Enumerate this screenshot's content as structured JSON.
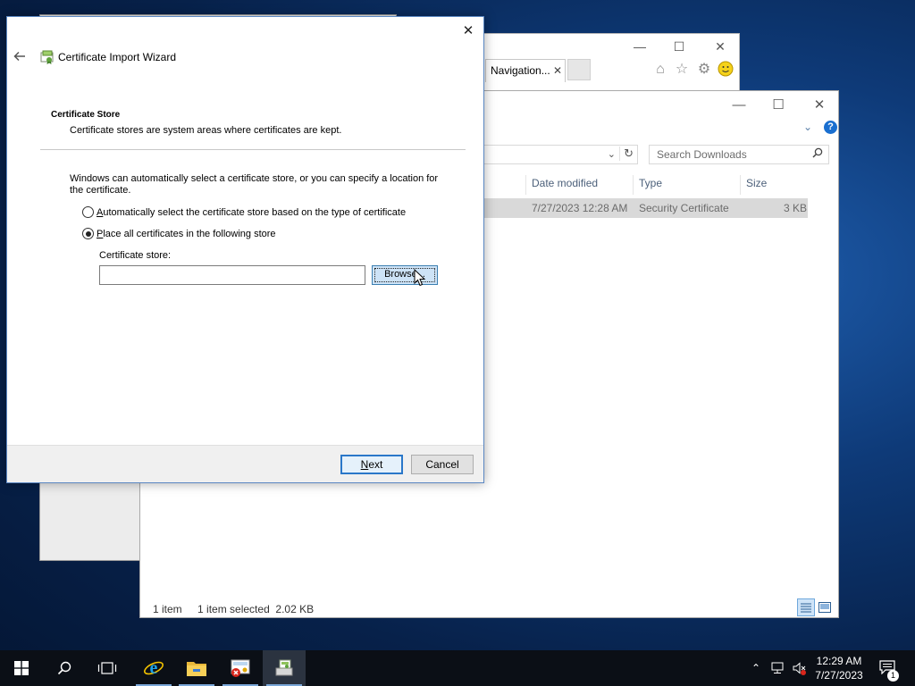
{
  "ie": {
    "tab_label": "Navigation...",
    "tab_close": "✕",
    "minimize": "—",
    "maximize": "☐",
    "close": "✕"
  },
  "explorer": {
    "minimize": "—",
    "maximize": "☐",
    "close": "✕",
    "search_placeholder": "Search Downloads",
    "columns": [
      "Date modified",
      "Type",
      "Size"
    ],
    "file": {
      "date_modified": "7/27/2023 12:28 AM",
      "type": "Security Certificate",
      "size": "3 KB"
    },
    "status_count": "1 item",
    "status_selection": "1 item selected  2.02 KB",
    "help_glyph": "?"
  },
  "wizard": {
    "title": "Certificate Import Wizard",
    "close": "✕",
    "section_title": "Certificate Store",
    "section_desc": "Certificate stores are system areas where certificates are kept.",
    "intro": "Windows can automatically select a certificate store, or you can specify a location for the certificate.",
    "option_auto": {
      "accel": "A",
      "rest": "utomatically select the certificate store based on the type of certificate",
      "checked": false
    },
    "option_place": {
      "accel": "P",
      "rest": "lace all certificates in the following store",
      "checked": true
    },
    "store_label": "Certificate store:",
    "store_value": "",
    "browse_label": "Browse...",
    "next": {
      "accel": "N",
      "rest": "ext"
    },
    "cancel_label": "Cancel"
  },
  "taskbar": {
    "time": "12:29 AM",
    "date": "7/27/2023",
    "notification_count": "1",
    "icons": [
      "start-icon",
      "search-icon",
      "task-view-icon",
      "internet-explorer-icon",
      "file-explorer-icon",
      "certificate-error-icon",
      "certificate-import-icon"
    ]
  },
  "colors": {
    "accent": "#2a77c9",
    "taskbar": "#0b0f16",
    "selection": "#cde3f7"
  }
}
